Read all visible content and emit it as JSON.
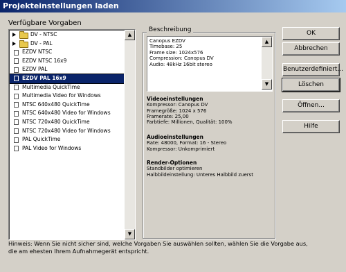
{
  "window": {
    "title": "Projekteinstellungen laden"
  },
  "presets": {
    "label": "Verfügbare Vorgaben",
    "items": [
      {
        "label": "DV - NTSC",
        "kind": "folder",
        "selected": false
      },
      {
        "label": "DV - PAL",
        "kind": "folder",
        "selected": false
      },
      {
        "label": "EZDV NTSC",
        "kind": "file",
        "selected": false
      },
      {
        "label": "EZDV NTSC 16x9",
        "kind": "file",
        "selected": false
      },
      {
        "label": "EZDV PAL",
        "kind": "file",
        "selected": false
      },
      {
        "label": "EZDV PAL 16x9",
        "kind": "file",
        "selected": true
      },
      {
        "label": "Multimedia QuickTime",
        "kind": "file",
        "selected": false
      },
      {
        "label": "Multimedia Video for Windows",
        "kind": "file",
        "selected": false
      },
      {
        "label": "NTSC 640x480 QuickTime",
        "kind": "file",
        "selected": false
      },
      {
        "label": "NTSC 640x480 Video for Windows",
        "kind": "file",
        "selected": false
      },
      {
        "label": "NTSC 720x480 QuickTime",
        "kind": "file",
        "selected": false
      },
      {
        "label": "NTSC 720x480 Video for Windows",
        "kind": "file",
        "selected": false
      },
      {
        "label": "PAL QuickTime",
        "kind": "file",
        "selected": false
      },
      {
        "label": "PAL Video for Windows",
        "kind": "file",
        "selected": false
      }
    ]
  },
  "description": {
    "label": "Beschreibung",
    "text": "Canopus EZDV\nTimebase: 25\nFrame size: 1024x576\nCompression: Canopus DV\nAudio: 48kHz 16bit stereo"
  },
  "video": {
    "heading": "Videoeinstellungen",
    "lines": [
      "Kompressor: Canopus DV",
      "Framegröße: 1024 x 576",
      "Framerate: 25,00",
      "Farbtiefe: Millionen, Qualität: 100%"
    ]
  },
  "audio": {
    "heading": "Audioeinstellungen",
    "lines": [
      "Rate: 48000, Format: 16 - Stereo",
      "Kompressor: Unkomprimiert"
    ]
  },
  "render": {
    "heading": "Render-Optionen",
    "lines": [
      "Standbilder optimieren",
      "Halbbildeinstellung: Unteres Halbbild zuerst"
    ]
  },
  "buttons": {
    "ok": "OK",
    "cancel": "Abbrechen",
    "custom": "Benutzerdefiniert...",
    "delete": "Löschen",
    "open": "Öffnen...",
    "help": "Hilfe"
  },
  "hint": {
    "line1": "Hinweis: Wenn Sie nicht sicher sind, welche Vorgaben Sie auswählen sollten, wählen Sie die Vorgabe aus,",
    "line2": "die am ehesten Ihrem Aufnahmegerät entspricht."
  }
}
